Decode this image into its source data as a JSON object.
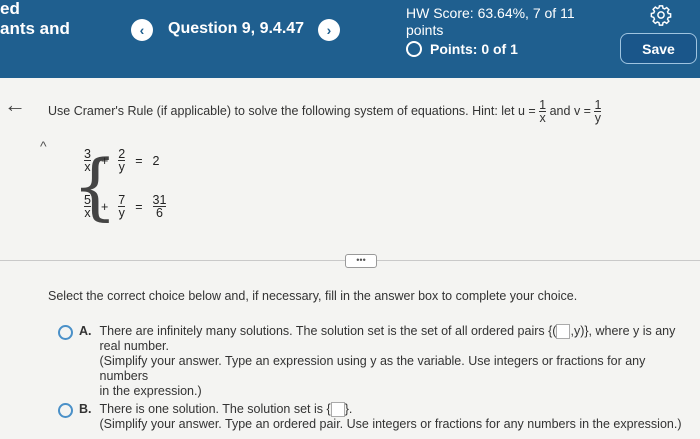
{
  "header": {
    "course_line1": "ed",
    "course_line2": "ants and",
    "prev_label": "‹",
    "next_label": "›",
    "question_title": "Question 9, 9.4.47",
    "hw_score_line1": "HW Score: 63.64%, 7 of 11",
    "hw_score_line2": "points",
    "points_label": "Points: 0 of 1",
    "save_label": "Save"
  },
  "nav": {
    "back_arrow": "←",
    "collapse_caret": "^"
  },
  "question": {
    "instruction": "Use Cramer's Rule (if applicable) to solve the following system of equations. Hint: let u =",
    "hint_and": "and v =",
    "hint_num": "1",
    "hint_den_u": "x",
    "hint_den_v": "y",
    "eq1": {
      "a_num": "3",
      "a_den": "x",
      "op": "+",
      "b_num": "2",
      "b_den": "y",
      "eq": "=",
      "rhs": "2"
    },
    "eq2": {
      "a_num": "5",
      "a_den": "x",
      "op": "+",
      "b_num": "7",
      "b_den": "y",
      "eq": "=",
      "rhs_num": "31",
      "rhs_den": "6"
    }
  },
  "divider_label": "•••",
  "prompt": "Select the correct choice below and, if necessary, fill in the answer box to complete your choice.",
  "choices": {
    "a": {
      "letter": "A.",
      "text1": "There are infinitely many solutions. The solution set is the set of all ordered pairs",
      "set_open": "{(",
      "set_close": ",y)}",
      "text1b": ", where y is any",
      "text2": "real number.",
      "note1": "(Simplify your answer. Type an expression using y as the variable. Use integers or fractions for any numbers",
      "note2": "in the expression.)"
    },
    "b": {
      "letter": "B.",
      "text1": "There is one solution. The solution set is",
      "set_open": "{",
      "set_close": "}.",
      "note": "(Simplify your answer. Type an ordered pair. Use integers or fractions for any numbers in the expression.)"
    }
  }
}
